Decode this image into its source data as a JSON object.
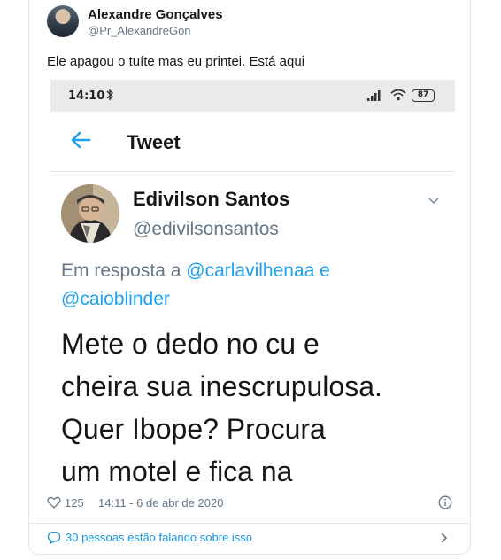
{
  "author": {
    "name": "Alexandre Gonçalves",
    "handle": "@Pr_AlexandreGon"
  },
  "tweet": {
    "text": "Ele apagou o tuíte mas eu printei. Está aqui"
  },
  "screenshot": {
    "status_bar": {
      "time": "14:10",
      "battery": "87"
    },
    "header": {
      "title": "Tweet"
    },
    "quoted": {
      "name": "Edivilson Santos",
      "handle": "@edivilsonsantos",
      "reply_prefix": "Em resposta a",
      "mention_1": "@carlavilhenaa",
      "reply_joiner": "e",
      "mention_2": "@caioblinder",
      "lines": [
        "Mete o dedo no cu e",
        "cheira sua inescrupulosa.",
        "Quer Ibope? Procura",
        "um motel e fica na"
      ]
    }
  },
  "footer": {
    "likes": "125",
    "timestamp": "14:11 - 6 de abr de 2020",
    "conversation": "30 pessoas estão falando sobre isso"
  },
  "colors": {
    "accent": "#1da1f2",
    "muted": "#657786",
    "link": "#1b95e0"
  }
}
